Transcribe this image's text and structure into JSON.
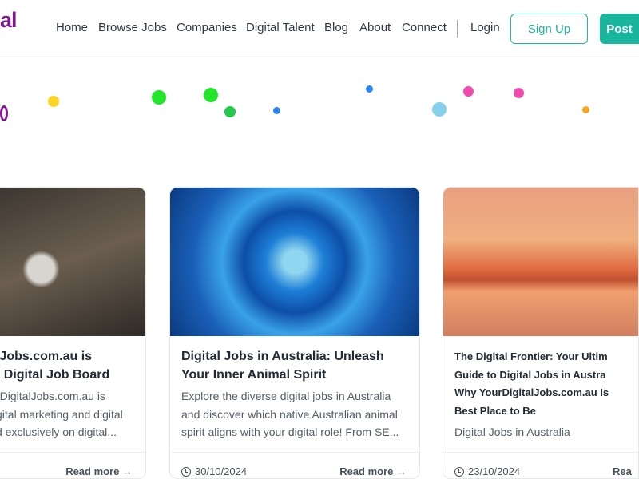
{
  "header": {
    "logo": "al",
    "nav": [
      "Home",
      "Browse Jobs",
      "Companies",
      "Digital Talent",
      "Blog",
      "About",
      "Connect"
    ],
    "login": "Login",
    "signup": "Sign Up",
    "post": "Post"
  },
  "colors": {
    "accent": "#19b59c",
    "brand": "#7a1a8c"
  },
  "cards": [
    {
      "title_l1": "lJobs.com.au is",
      "title_l2": "t Digital Job Board",
      "excerpt": [
        "rDigitalJobs.com.au is",
        "gital marketing and digital",
        "d exclusively on digital..."
      ],
      "date": "",
      "read_more": "Read more →"
    },
    {
      "title_l1": "Digital Jobs in Australia: Unleash",
      "title_l2": "Your Inner Animal Spirit",
      "excerpt": [
        "Explore the diverse digital jobs in Australia",
        "and discover which native Australian animal",
        "spirit aligns with your digital role! From SE..."
      ],
      "date": "30/10/2024",
      "read_more": "Read more →"
    },
    {
      "title": [
        "The Digital Frontier: Your Ultim",
        "Guide to Digital Jobs in Austra",
        "Why YourDigitalJobs.com.au Is",
        "Best Place to Be"
      ],
      "category": "Digital Jobs in Australia",
      "date": "23/10/2024",
      "read_more": "Rea"
    }
  ]
}
